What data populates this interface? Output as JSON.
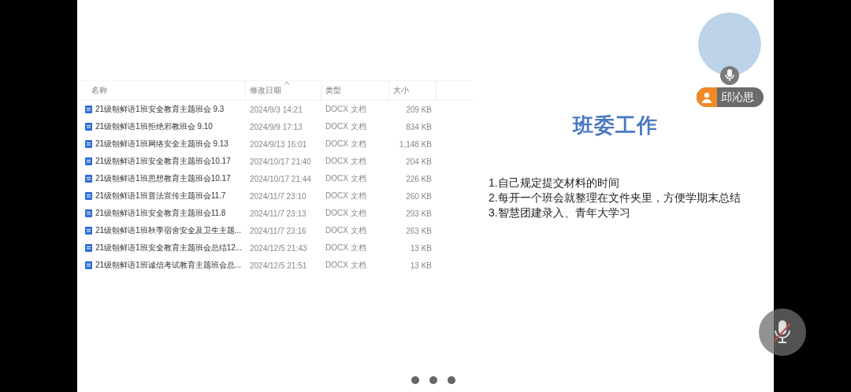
{
  "file_table": {
    "columns": [
      {
        "label": "名称",
        "sorted": false
      },
      {
        "label": "修改日期",
        "sorted": true
      },
      {
        "label": "类型",
        "sorted": false
      },
      {
        "label": "大小",
        "sorted": false
      }
    ],
    "rows": [
      {
        "name": "21级朝鲜语1班安全教育主题班会 9.3",
        "date": "2024/9/3 14:21",
        "type": "DOCX 文档",
        "size": "209 KB"
      },
      {
        "name": "21级朝鲜语1班拒绝邪教班会 9.10",
        "date": "2024/9/9 17:13",
        "type": "DOCX 文档",
        "size": "834 KB"
      },
      {
        "name": "21级朝鲜语1班网络安全主题班会 9.13",
        "date": "2024/9/13 16:01",
        "type": "DOCX 文档",
        "size": "1,148 KB"
      },
      {
        "name": "21级朝鲜语1班安全教育主题班会10.17",
        "date": "2024/10/17 21:40",
        "type": "DOCX 文档",
        "size": "204 KB"
      },
      {
        "name": "21级朝鲜语1班思想教育主题班会10.17",
        "date": "2024/10/17 21:44",
        "type": "DOCX 文档",
        "size": "226 KB"
      },
      {
        "name": "21级朝鲜语1班普法宣传主题班会11.7",
        "date": "2024/11/7 23:10",
        "type": "DOCX 文档",
        "size": "260 KB"
      },
      {
        "name": "21级朝鲜语1班安全教育主题班会11.8",
        "date": "2024/11/7 23:13",
        "type": "DOCX 文档",
        "size": "293 KB"
      },
      {
        "name": "21级朝鲜语1班秋季宿舍安全及卫生主题...",
        "date": "2024/11/7 23:16",
        "type": "DOCX 文档",
        "size": "263 KB"
      },
      {
        "name": "21级朝鲜语1班安全教育主题班会总结12...",
        "date": "2024/12/5 21:43",
        "type": "DOCX 文档",
        "size": "13 KB"
      },
      {
        "name": "21级朝鲜语1班诚信考试教育主题班会总...",
        "date": "2024/12/5 21:51",
        "type": "DOCX 文档",
        "size": "13 KB"
      }
    ]
  },
  "slide": {
    "title": "班委工作",
    "points": [
      "1.自己规定提交材料的时间",
      "2.每开一个班会就整理在文件夹里，方便学期末总结",
      "3.智慧团建录入、青年大学习"
    ]
  },
  "participant": {
    "name": "邱沁思"
  },
  "mute_button": {
    "muted": true
  },
  "page_dots": [
    {
      "selected": false
    },
    {
      "selected": false
    },
    {
      "selected": false
    }
  ]
}
